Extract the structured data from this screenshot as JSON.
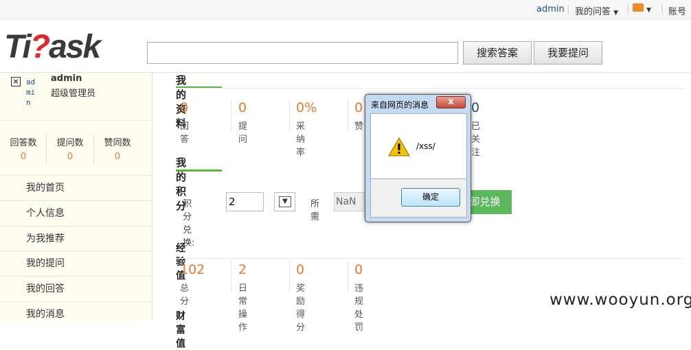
{
  "topbar": {
    "user": "admin",
    "my_qa": "我的问答",
    "account": "账号"
  },
  "logo": {
    "part1": "Ti",
    "part2": "?",
    "part3": "ask"
  },
  "search": {
    "value": "",
    "button": "搜索答案",
    "ask_button": "我要提问"
  },
  "profile": {
    "avatar_alt": "ad mi n",
    "name": "admin",
    "role": "超级管理员"
  },
  "side_stats": [
    {
      "label": "回答数",
      "value": "0"
    },
    {
      "label": "提问数",
      "value": "0"
    },
    {
      "label": "赞同数",
      "value": "0"
    }
  ],
  "menu": [
    "我的首页",
    "个人信息",
    "为我推荐",
    "我的提问",
    "我的回答",
    "我的消息"
  ],
  "my_profile": {
    "title": "我的资料",
    "stats": [
      {
        "value": "0",
        "label": "回答"
      },
      {
        "value": "0",
        "label": "提问"
      },
      {
        "value": "0%",
        "label": "采纳率"
      },
      {
        "value": "0",
        "label": "赞"
      },
      {
        "value": "0",
        "label": "已关注"
      }
    ]
  },
  "my_points": {
    "title": "我的积分",
    "exchange_label": "积分兑换:",
    "exchange_value": "2",
    "need_label": "所需",
    "need_value": "NaN",
    "exchange_button": "立即兑换"
  },
  "experience": {
    "title": "经验值",
    "stats": [
      {
        "value": "102",
        "label": "总分"
      },
      {
        "value": "2",
        "label": "日常操作"
      },
      {
        "value": "0",
        "label": "奖励得分"
      },
      {
        "value": "0",
        "label": "违规处罚"
      }
    ]
  },
  "wealth": {
    "title": "财富值"
  },
  "dialog": {
    "title": "来自网页的消息",
    "message": "/xss/",
    "ok": "确定",
    "close": "x"
  },
  "watermark": "www.wooyun.org",
  "colors": {
    "accent_green": "#58b73d",
    "number_orange": "#e9782f",
    "link_blue": "#1a4d8c"
  }
}
